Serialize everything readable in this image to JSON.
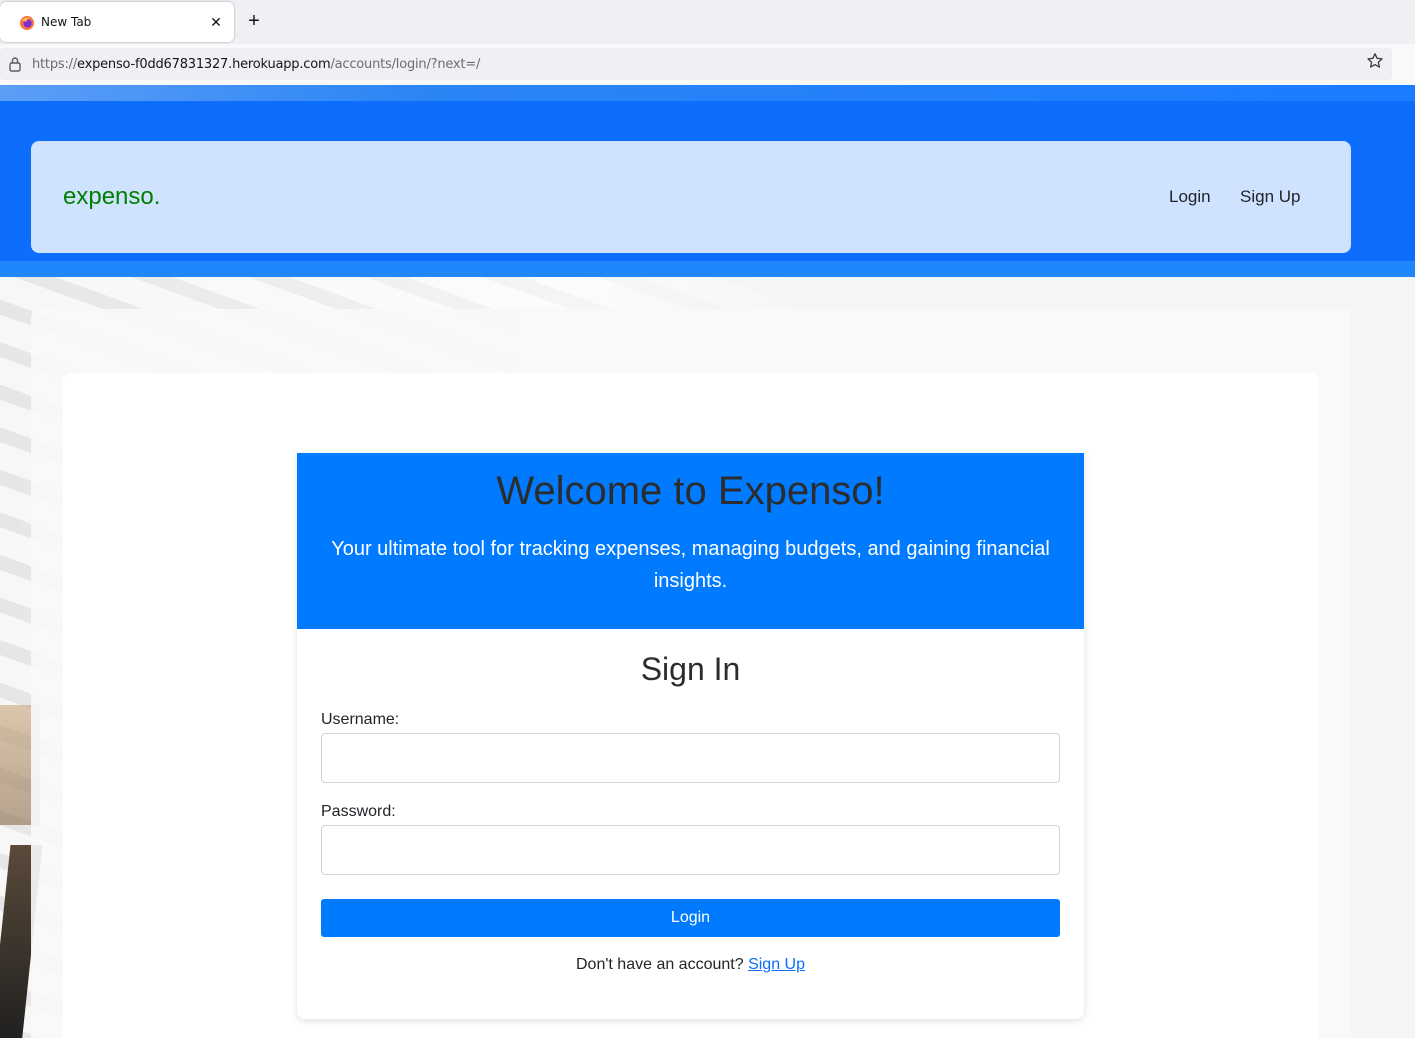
{
  "browser": {
    "tab_title": "New Tab",
    "tab_close": "✕",
    "new_tab": "+",
    "url_prefix": "https://",
    "url_host": "expenso-f0dd67831327.herokuapp.com",
    "url_path": "/accounts/login/?next=/"
  },
  "navbar": {
    "brand": "expenso.",
    "login": "Login",
    "signup": "Sign Up"
  },
  "welcome": {
    "title": "Welcome to Expenso!",
    "subtitle": "Your ultimate tool for tracking expenses, managing budgets, and gaining financial insights."
  },
  "form": {
    "title": "Sign In",
    "username_label": "Username:",
    "username_value": "",
    "password_label": "Password:",
    "password_value": "",
    "submit": "Login",
    "signup_prompt": "Don't have an account?",
    "signup_link": "Sign Up"
  },
  "colors": {
    "primary": "#007bff",
    "navbar_bg": "#cfe2ff",
    "brand": "#008000"
  }
}
